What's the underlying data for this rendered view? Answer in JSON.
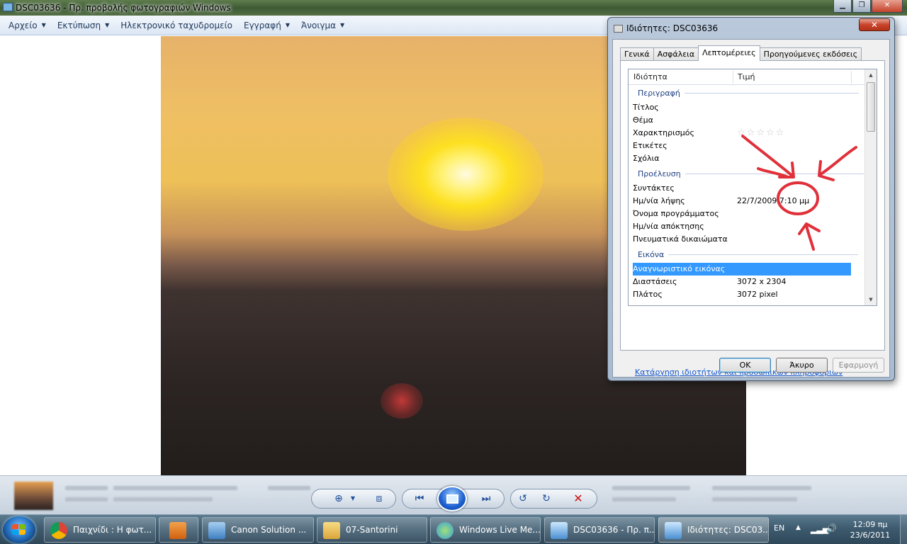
{
  "window": {
    "title": "DSC03636 - Πρ. προβολής φωτογραφιών Windows"
  },
  "menu": [
    {
      "label": "Αρχείο",
      "has_caret": true
    },
    {
      "label": "Εκτύπωση",
      "has_caret": true
    },
    {
      "label": "Ηλεκτρονικό ταχυδρομείο",
      "has_caret": false
    },
    {
      "label": "Εγγραφή",
      "has_caret": true
    },
    {
      "label": "Άνοιγμα",
      "has_caret": true
    }
  ],
  "dialog": {
    "title": "Ιδιότητες: DSC03636",
    "tabs": [
      "Γενικά",
      "Ασφάλεια",
      "Λεπτομέρειες",
      "Προηγούμενες εκδόσεις"
    ],
    "active_tab": "Λεπτομέρειες",
    "columns": {
      "property": "Ιδιότητα",
      "value": "Τιμή"
    },
    "groups": {
      "description": "Περιγραφή",
      "origin": "Προέλευση",
      "image": "Εικόνα"
    },
    "rows": {
      "title": {
        "name": "Τίτλος",
        "value": ""
      },
      "subject": {
        "name": "Θέμα",
        "value": ""
      },
      "rating": {
        "name": "Χαρακτηρισμός",
        "stars": 0,
        "max_stars": 5
      },
      "tags": {
        "name": "Ετικέτες",
        "value": ""
      },
      "comments": {
        "name": "Σχόλια",
        "value": ""
      },
      "authors": {
        "name": "Συντάκτες",
        "value": ""
      },
      "date_taken": {
        "name": "Ημ/νία λήψης",
        "value": "22/7/2009 7:10 μμ"
      },
      "program_name": {
        "name": "Όνομα προγράμματος",
        "value": ""
      },
      "date_acquired": {
        "name": "Ημ/νία απόκτησης",
        "value": ""
      },
      "copyright": {
        "name": "Πνευματικά δικαιώματα",
        "value": ""
      },
      "image_id": {
        "name": "Αναγνωριστικό εικόνας",
        "value": ""
      },
      "dimensions": {
        "name": "Διαστάσεις",
        "value": "3072 x 2304"
      },
      "width": {
        "name": "Πλάτος",
        "value": "3072 pixel"
      }
    },
    "remove_link": "Κατάργηση ιδιοτήτων και προσωπικών πληροφοριών",
    "buttons": {
      "ok": "OK",
      "cancel": "Άκυρο",
      "apply": "Εφαρμογή"
    }
  },
  "taskbar": {
    "items": [
      {
        "label": "Παιχνίδι : Η φωτ...",
        "icon": "chrome-icon",
        "color": "#d9412e"
      },
      {
        "label": "",
        "icon": "media-player-icon",
        "color": "#e07a20"
      },
      {
        "label": "Canon Solution ...",
        "icon": "canon-icon",
        "color": "#6aa0d8"
      },
      {
        "label": "07-Santorini",
        "icon": "folder-icon",
        "color": "#e8c25a"
      },
      {
        "label": "Windows Live Me...",
        "icon": "messenger-icon",
        "color": "#5bb0e8"
      },
      {
        "label": "DSC03636 - Πρ. π...",
        "icon": "photo-viewer-icon",
        "color": "#7ab4e4"
      },
      {
        "label": "Ιδιότητες: DSC03...",
        "icon": "properties-icon",
        "color": "#7ab4e4"
      }
    ],
    "language": "EN",
    "time": "12:09 πμ",
    "date": "23/6/2011"
  },
  "colors": {
    "selection": "#3399ff",
    "group_header": "#1e3f80",
    "link": "#1155cc",
    "annotation": "#e0303a"
  }
}
